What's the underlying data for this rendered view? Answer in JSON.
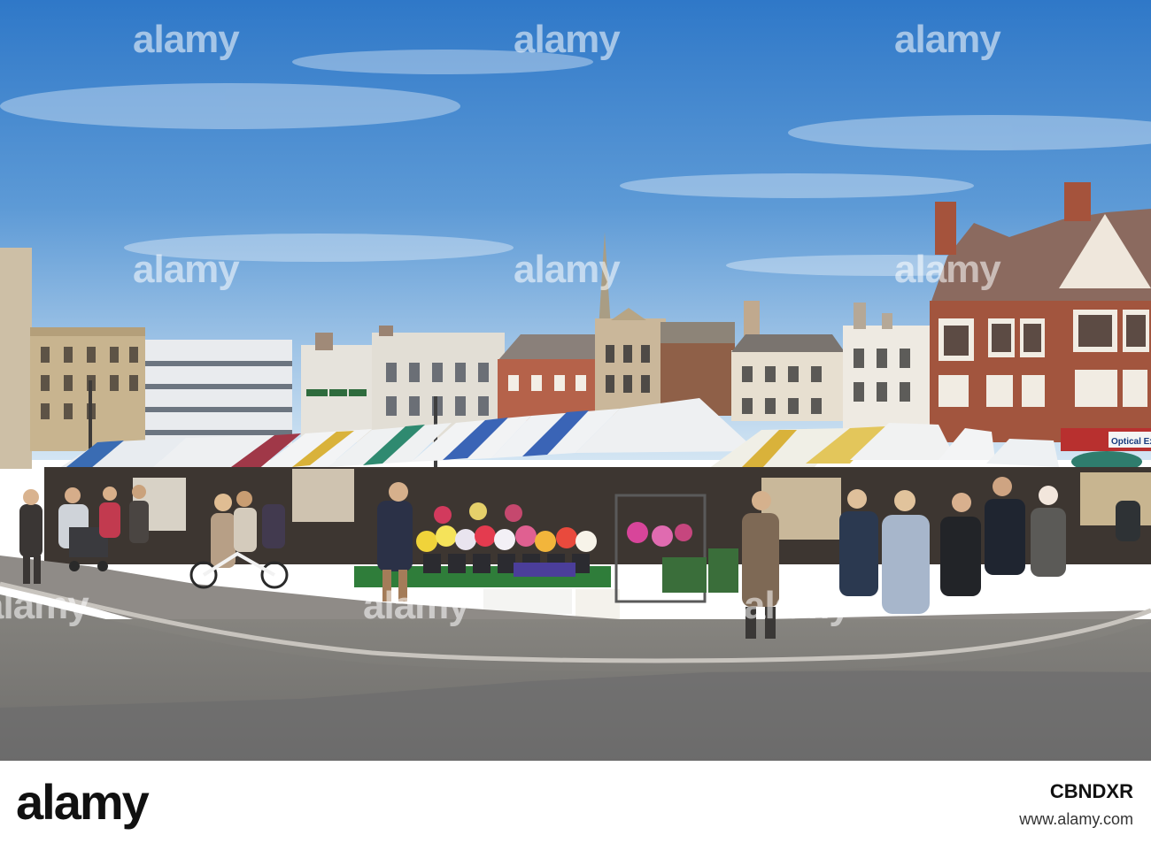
{
  "watermark": {
    "text": "alamy"
  },
  "shop_sign": {
    "text": "Optical Ex"
  },
  "footer": {
    "logo": "alamy",
    "image_id": "CBNDXR",
    "url": "www.alamy.com"
  },
  "colors": {
    "sky_top": "#2f78c8",
    "sky_bottom": "#cfe2f2",
    "road": "#7c7a78",
    "pavement": "#8f8b87",
    "brick": "#a2553e",
    "awning_blue": "#3a64b6",
    "awning_yellow": "#d9b23a",
    "awning_green": "#2f8a70",
    "awning_red": "#a03848",
    "stall_green": "#2f7d3a"
  }
}
